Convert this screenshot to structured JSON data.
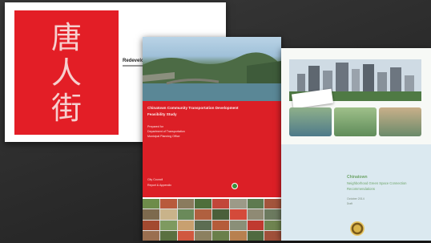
{
  "documents": [
    {
      "id_label": "chinatown-cover",
      "chinese_title": [
        "唐",
        "人",
        "街"
      ],
      "side_text": "Redevelopment",
      "brand_colors": {
        "red": "#e31e26"
      }
    },
    {
      "id_label": "planning-report",
      "heading": "Chinatown Community Transportation Development",
      "subheading": "Feasibility Study",
      "body_lines": [
        "Prepared for",
        "Department of Transportation",
        "Municipal Planning Office"
      ],
      "footer_lines": [
        "City Council",
        "Report & Appendix"
      ],
      "band_color": "#dc1f26"
    },
    {
      "id_label": "greenway-plan",
      "heading": "Chinatown",
      "subheading_1": "Neighborhood Green Space Connection",
      "subheading_2": "Recommendations",
      "date_line": "October 2014",
      "small_line": "Draft",
      "text_color": "#6fa56a"
    }
  ]
}
